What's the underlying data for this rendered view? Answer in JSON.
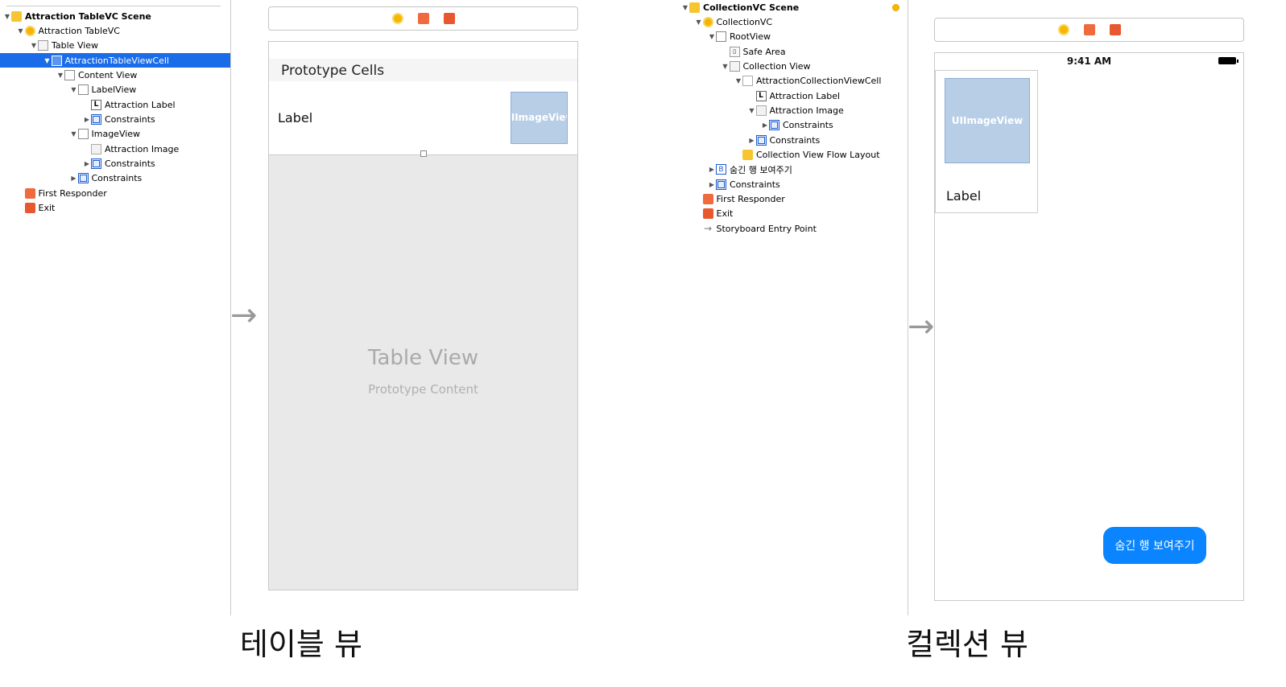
{
  "left_outline": {
    "items": [
      {
        "label": "Attraction TableVC Scene",
        "icon": "scene-icon",
        "depth": 0,
        "disclosure": "open",
        "bold": true
      },
      {
        "label": "Attraction TableVC",
        "icon": "view-controller-icon",
        "depth": 1,
        "disclosure": "open"
      },
      {
        "label": "Table View",
        "icon": "table-view-icon",
        "depth": 2,
        "disclosure": "open"
      },
      {
        "label": "AttractionTableViewCell",
        "icon": "table-cell-icon",
        "depth": 3,
        "disclosure": "open",
        "selected": true
      },
      {
        "label": "Content View",
        "icon": "view-icon",
        "depth": 4,
        "disclosure": "open"
      },
      {
        "label": "LabelView",
        "icon": "view-icon",
        "depth": 5,
        "disclosure": "open"
      },
      {
        "label": "Attraction Label",
        "icon": "label-icon",
        "depth": 6,
        "disclosure": "none"
      },
      {
        "label": "Constraints",
        "icon": "constraints-icon",
        "depth": 6,
        "disclosure": "closed"
      },
      {
        "label": "ImageView",
        "icon": "view-icon",
        "depth": 5,
        "disclosure": "open"
      },
      {
        "label": "Attraction Image",
        "icon": "image-view-icon",
        "depth": 6,
        "disclosure": "none"
      },
      {
        "label": "Constraints",
        "icon": "constraints-icon",
        "depth": 6,
        "disclosure": "closed"
      },
      {
        "label": "Constraints",
        "icon": "constraints-icon",
        "depth": 5,
        "disclosure": "closed"
      },
      {
        "label": "First Responder",
        "icon": "first-responder-icon",
        "depth": 1,
        "disclosure": "none"
      },
      {
        "label": "Exit",
        "icon": "exit-icon",
        "depth": 1,
        "disclosure": "none"
      }
    ]
  },
  "right_outline": {
    "items": [
      {
        "label": "CollectionVC Scene",
        "icon": "scene-icon",
        "depth": 0,
        "disclosure": "open",
        "bold": true
      },
      {
        "label": "CollectionVC",
        "icon": "view-controller-icon",
        "depth": 1,
        "disclosure": "open"
      },
      {
        "label": "RootView",
        "icon": "view-icon",
        "depth": 2,
        "disclosure": "open"
      },
      {
        "label": "Safe Area",
        "icon": "safe-area-icon",
        "depth": 3,
        "disclosure": "none"
      },
      {
        "label": "Collection View",
        "icon": "collection-view-icon",
        "depth": 3,
        "disclosure": "open"
      },
      {
        "label": "AttractionCollectionViewCell",
        "icon": "collection-cell-icon",
        "depth": 4,
        "disclosure": "open"
      },
      {
        "label": "Attraction Label",
        "icon": "label-icon",
        "depth": 5,
        "disclosure": "none"
      },
      {
        "label": "Attraction Image",
        "icon": "image-view-icon",
        "depth": 5,
        "disclosure": "open"
      },
      {
        "label": "Constraints",
        "icon": "constraints-icon",
        "depth": 6,
        "disclosure": "closed"
      },
      {
        "label": "Constraints",
        "icon": "constraints-icon",
        "depth": 5,
        "disclosure": "closed"
      },
      {
        "label": "Collection View Flow Layout",
        "icon": "flow-layout-icon",
        "depth": 4,
        "disclosure": "none"
      },
      {
        "label": "숨긴 행 보여주기",
        "icon": "button-icon",
        "depth": 2,
        "disclosure": "closed"
      },
      {
        "label": "Constraints",
        "icon": "constraints-icon",
        "depth": 2,
        "disclosure": "closed"
      },
      {
        "label": "First Responder",
        "icon": "first-responder-icon",
        "depth": 1,
        "disclosure": "none"
      },
      {
        "label": "Exit",
        "icon": "exit-icon",
        "depth": 1,
        "disclosure": "none"
      },
      {
        "label": "Storyboard Entry Point",
        "icon": "entry-arrow-icon",
        "depth": 1,
        "disclosure": "none"
      }
    ]
  },
  "table_canvas": {
    "prototype_header": "Prototype Cells",
    "cell_label": "Label",
    "cell_image": "UIImageView",
    "placeholder_title": "Table View",
    "placeholder_subtitle": "Prototype Content"
  },
  "collection_canvas": {
    "status_time": "9:41 AM",
    "cell_image": "UIImageView",
    "cell_label": "Label",
    "button_label": "숨긴 행 보여주기"
  },
  "captions": {
    "left": "테이블 뷰",
    "right": "컬렉션 뷰"
  },
  "colors": {
    "selection": "#1a6ce8",
    "image_placeholder": "#b8cde6",
    "button": "#0a84ff"
  }
}
